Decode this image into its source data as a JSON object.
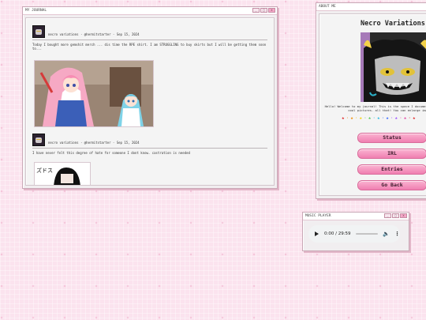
{
  "journal": {
    "title": "MY JOURNAL",
    "posts": [
      {
        "meta": "necro variations · @hermitstarter · Sep 15, 2024",
        "text": "Today I bought more gemshit merch ... dis time the RPE shirt. I am STRUGGLING to buy skirts but I will be getting them soon to..."
      },
      {
        "meta": "necro variations · @hermitstarter · Sep 15, 2024",
        "text": "I have never felt this degree of hate for someone I dont know. castration is needed"
      }
    ],
    "manga_text": "ズドス"
  },
  "about": {
    "title": "ABOUT ME",
    "heading": "Necro Variations",
    "bio": "Hello! Welcome to my journal! This is the space I document thoughts, host cool pictures. all that! You can enlarge images",
    "stars": [
      "★",
      "·",
      "★",
      "·",
      "★",
      "·",
      "★",
      "·",
      "★",
      "·",
      "★",
      "·",
      "★",
      "·",
      "★",
      "·",
      "★"
    ],
    "star_colors": [
      "#e02424",
      "#f28c00",
      "#f5d000",
      "#4cc44c",
      "#22b8e0",
      "#3366ff",
      "#9b4dff",
      "#e040a0"
    ],
    "buttons": {
      "status": "Status",
      "irl": "IRL",
      "entries": "Entries",
      "back": "Go Back"
    }
  },
  "music": {
    "title": "MUSIC PLAYER",
    "time": "0:00 / 29:59"
  },
  "window_buttons": {
    "min": "_",
    "max": "□",
    "close": "x"
  }
}
